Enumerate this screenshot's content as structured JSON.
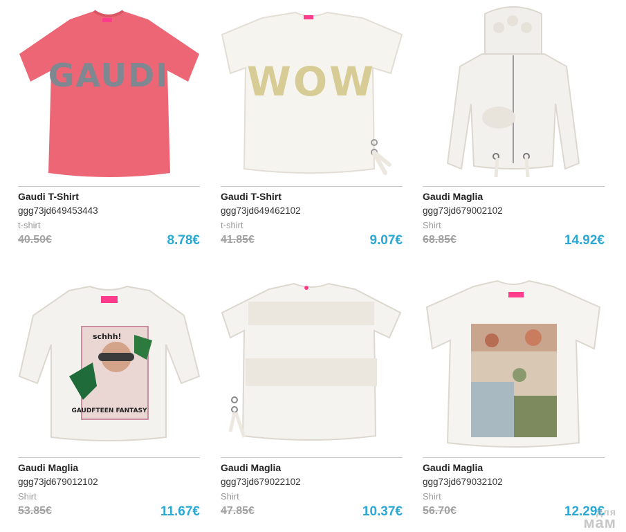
{
  "products": [
    {
      "name": "Gaudi T-Shirt",
      "code": "ggg73jd649453443",
      "category": "t-shirt",
      "old_price": "40.50€",
      "price": "8.78€",
      "print_text": "GAUDI"
    },
    {
      "name": "Gaudi T-Shirt",
      "code": "ggg73jd649462102",
      "category": "t-shirt",
      "old_price": "41.85€",
      "price": "9.07€",
      "print_text": "WOW"
    },
    {
      "name": "Gaudi Maglia",
      "code": "ggg73jd679002102",
      "category": "Shirt",
      "old_price": "68.85€",
      "price": "14.92€"
    },
    {
      "name": "Gaudi Maglia",
      "code": "ggg73jd679012102",
      "category": "Shirt",
      "old_price": "53.85€",
      "price": "11.67€",
      "print_text_top": "schhh!",
      "print_text_bottom": "GAUDFTEEN FANTASY"
    },
    {
      "name": "Gaudi Maglia",
      "code": "ggg73jd679022102",
      "category": "Shirt",
      "old_price": "47.85€",
      "price": "10.37€"
    },
    {
      "name": "Gaudi Maglia",
      "code": "ggg73jd679032102",
      "category": "Shirt",
      "old_price": "56.70€",
      "price": "12.29€"
    }
  ],
  "watermark": {
    "top": "для",
    "bottom": "мам"
  },
  "colors": {
    "price": "#2aa8d6",
    "old_price": "#a2a2a2",
    "coral_tee": "#ec6675",
    "label_pink": "#ff3c8c"
  }
}
